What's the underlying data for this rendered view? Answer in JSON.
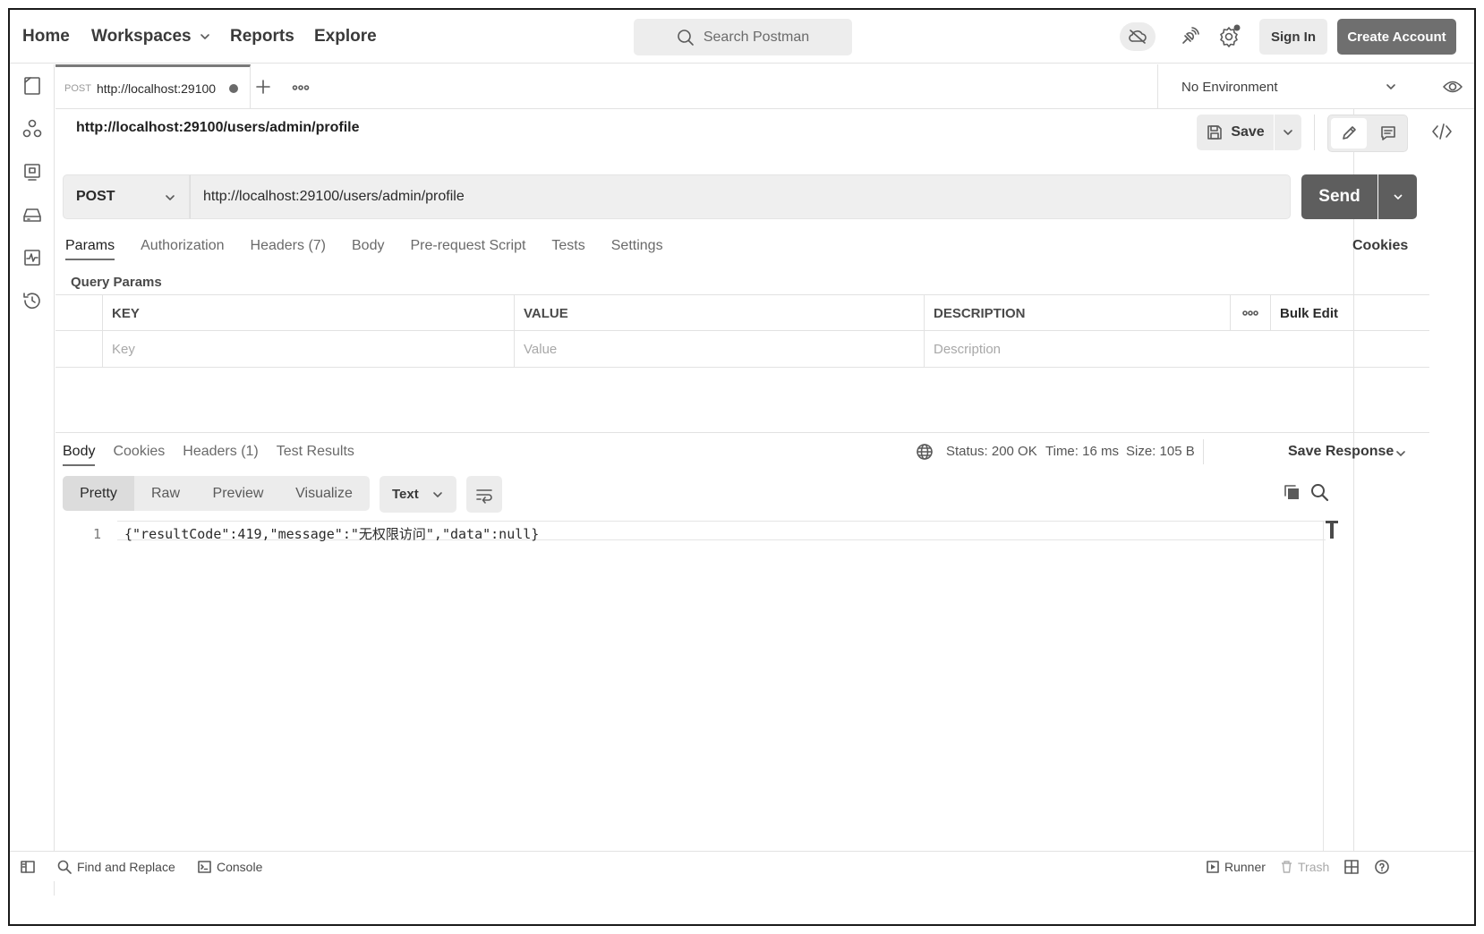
{
  "topbar": {
    "nav": [
      "Home",
      "Workspaces",
      "Reports",
      "Explore"
    ],
    "search_placeholder": "Search Postman",
    "sign_in": "Sign In",
    "create_account": "Create Account"
  },
  "tab": {
    "method": "POST",
    "url": "http://localhost:29100"
  },
  "environment": "No Environment",
  "request": {
    "title": "http://localhost:29100/users/admin/profile",
    "save_label": "Save",
    "method": "POST",
    "url": "http://localhost:29100/users/admin/profile",
    "send_label": "Send",
    "tabs": [
      "Params",
      "Authorization",
      "Headers (7)",
      "Body",
      "Pre-request Script",
      "Tests",
      "Settings"
    ],
    "cookies_label": "Cookies",
    "query_params_label": "Query Params",
    "table": {
      "headers": [
        "KEY",
        "VALUE",
        "DESCRIPTION"
      ],
      "bulk_edit": "Bulk Edit",
      "placeholders": [
        "Key",
        "Value",
        "Description"
      ]
    }
  },
  "response": {
    "tabs": [
      "Body",
      "Cookies",
      "Headers (1)",
      "Test Results"
    ],
    "status": "Status: 200 OK",
    "time": "Time: 16 ms",
    "size": "Size: 105 B",
    "save_response": "Save Response",
    "view_modes": [
      "Pretty",
      "Raw",
      "Preview",
      "Visualize"
    ],
    "format": "Text",
    "line_number": "1",
    "body_text": "{\"resultCode\":419,\"message\":\"无权限访问\",\"data\":null}"
  },
  "footer": {
    "find_replace": "Find and Replace",
    "console": "Console",
    "runner": "Runner",
    "trash": "Trash"
  }
}
